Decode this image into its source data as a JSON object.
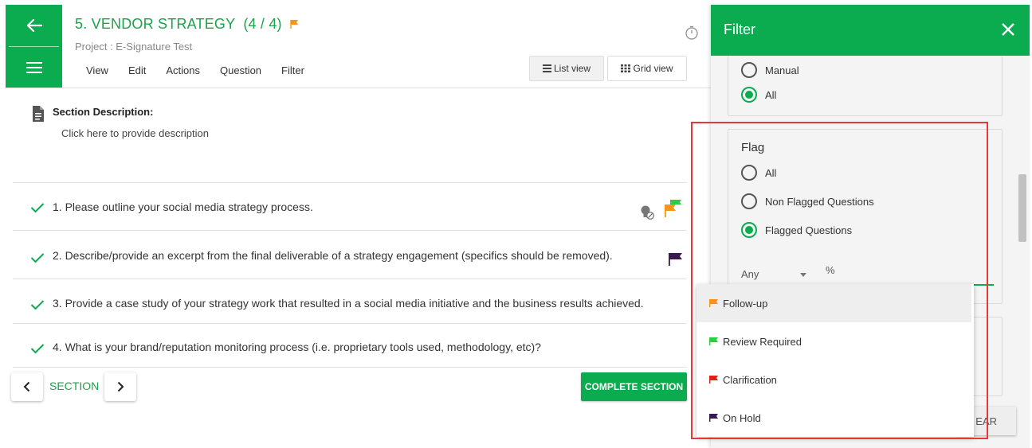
{
  "header": {
    "title": "5. VENDOR STRATEGY",
    "count": "(4 / 4)",
    "project": "Project : E-Signature Test",
    "menu": [
      "View",
      "Edit",
      "Actions",
      "Question",
      "Filter"
    ],
    "list_view": "List view",
    "grid_view": "Grid view"
  },
  "section": {
    "desc_label": "Section Description:",
    "desc_placeholder": "Click here to provide description"
  },
  "questions": [
    {
      "text": "1. Please outline your social media strategy process."
    },
    {
      "text": "2. Describe/provide an excerpt from the final deliverable of a strategy engagement (specifics should be removed)."
    },
    {
      "text": "3. Provide a case study of your strategy work that resulted in a social media initiative and the business results achieved."
    },
    {
      "text": "4. What is your brand/reputation monitoring process (i.e. proprietary tools used, methodology, etc)?"
    }
  ],
  "footer": {
    "section_label": "SECTION",
    "complete": "COMPLETE SECTION"
  },
  "filter": {
    "title": "Filter",
    "top_options": [
      "Manual",
      "All"
    ],
    "flag_title": "Flag",
    "flag_options": [
      "All",
      "Non Flagged Questions",
      "Flagged Questions"
    ],
    "any": "Any",
    "percent": "%",
    "clear_partial": "EAR"
  },
  "flag_dropdown": [
    {
      "label": "Follow-up",
      "color": "#f7941d"
    },
    {
      "label": "Review Required",
      "color": "#2ecc40"
    },
    {
      "label": "Clarification",
      "color": "#e0201b"
    },
    {
      "label": "On Hold",
      "color": "#3b1a4f"
    }
  ],
  "colors": {
    "brand_green": "#0bac4f",
    "highlight_red": "#e53935"
  }
}
